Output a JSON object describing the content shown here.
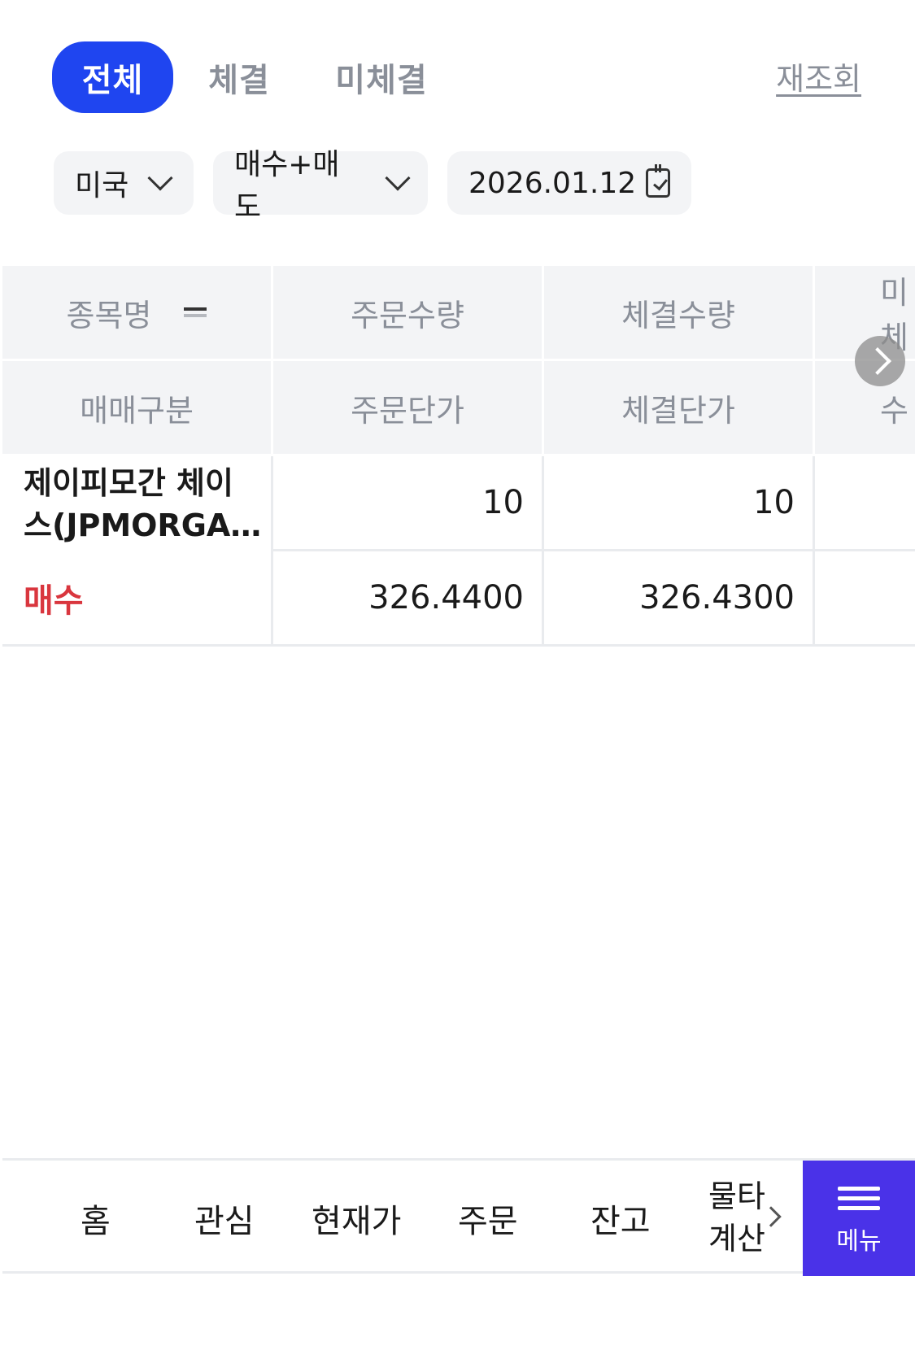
{
  "tabs": [
    {
      "label": "전체",
      "active": true
    },
    {
      "label": "체결",
      "active": false
    },
    {
      "label": "미체결",
      "active": false
    }
  ],
  "refresh_label": "재조회",
  "filters": {
    "country": "미국",
    "side": "매수+매도",
    "date": "2026.01.12"
  },
  "table": {
    "headers_row1": [
      "종목명",
      "주문수량",
      "체결수량",
      "미체"
    ],
    "headers_row2": [
      "매매구분",
      "주문단가",
      "체결단가",
      "수"
    ],
    "rows": [
      {
        "name_line1": "제이피모간 체이",
        "name_line2": "스(JPMORGA…",
        "order_qty": "10",
        "filled_qty": "10",
        "side": "매수",
        "order_price": "326.4400",
        "filled_price": "326.4300"
      }
    ]
  },
  "bottom_nav": {
    "items": [
      "홈",
      "관심",
      "현재가",
      "주문",
      "잔고"
    ],
    "more_line1": "물타기",
    "more_line2": "계산기",
    "menu_label": "메뉴"
  },
  "colors": {
    "accent": "#1f45f0",
    "menu": "#4a32e8",
    "buy": "#d9363e"
  }
}
